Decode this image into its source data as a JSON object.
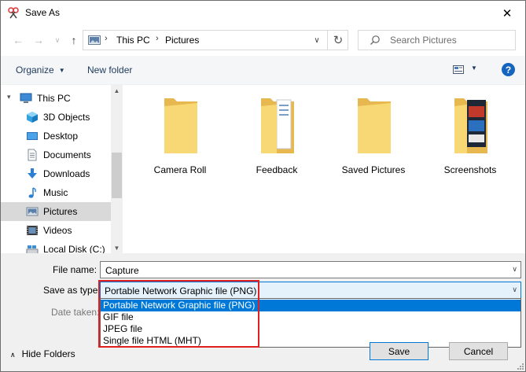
{
  "window": {
    "title": "Save As",
    "close_glyph": "✕"
  },
  "nav_buttons": {
    "back": "←",
    "forward": "→",
    "recent": "∨",
    "up": "↑"
  },
  "address": {
    "crumbs": [
      "This PC",
      "Pictures"
    ],
    "separator": "›",
    "dropdown": "∨",
    "refresh": "↻"
  },
  "search": {
    "placeholder": "Search Pictures"
  },
  "commandbar": {
    "organize": "Organize",
    "new_folder": "New folder",
    "help": "?",
    "caret": "▼"
  },
  "sidebar": {
    "items": [
      {
        "label": "This PC",
        "icon": "computer-icon",
        "selected": false
      },
      {
        "label": "3D Objects",
        "icon": "3d-objects-icon",
        "selected": false
      },
      {
        "label": "Desktop",
        "icon": "desktop-icon",
        "selected": false
      },
      {
        "label": "Documents",
        "icon": "documents-icon",
        "selected": false
      },
      {
        "label": "Downloads",
        "icon": "downloads-icon",
        "selected": false
      },
      {
        "label": "Music",
        "icon": "music-icon",
        "selected": false
      },
      {
        "label": "Pictures",
        "icon": "pictures-icon",
        "selected": true
      },
      {
        "label": "Videos",
        "icon": "videos-icon",
        "selected": false
      },
      {
        "label": "Local Disk (C:)",
        "icon": "drive-icon",
        "selected": false
      }
    ],
    "expander": "▾",
    "scroll_up": "▲",
    "scroll_down": "▼"
  },
  "folders": [
    {
      "label": "Camera Roll"
    },
    {
      "label": "Feedback"
    },
    {
      "label": "Saved Pictures"
    },
    {
      "label": "Screenshots"
    }
  ],
  "form": {
    "file_name_label": "File name:",
    "file_name_value": "Capture",
    "save_type_label": "Save as type:",
    "save_type_value": "Portable Network Graphic file (PNG)",
    "date_taken_label": "Date taken:",
    "dropdown_caret": "∨",
    "type_options": [
      "Portable Network Graphic file (PNG)",
      "GIF file",
      "JPEG file",
      "Single file HTML (MHT)"
    ]
  },
  "footer": {
    "hide_folders": "Hide Folders",
    "caret": "∧",
    "save": "Save",
    "cancel": "Cancel"
  },
  "colors": {
    "accent": "#0078d7",
    "highlight_border": "#e02020",
    "folder": "#f8d775",
    "selection": "#d9d9d9"
  }
}
